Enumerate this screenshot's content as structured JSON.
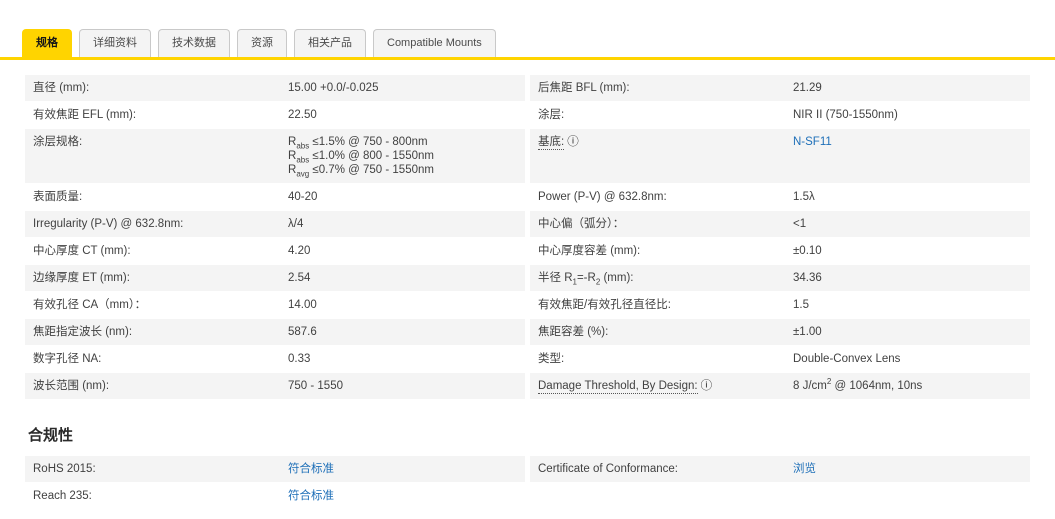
{
  "tabs": [
    {
      "label": "规格",
      "active": true
    },
    {
      "label": "详细资料",
      "active": false
    },
    {
      "label": "技术数据",
      "active": false
    },
    {
      "label": "资源",
      "active": false
    },
    {
      "label": "相关产品",
      "active": false
    },
    {
      "label": "Compatible Mounts",
      "active": false
    }
  ],
  "icons": {
    "info": "ⓘ"
  },
  "colors": {
    "accent_yellow": "#ffd400",
    "link_blue": "#1e6fb8",
    "row_stripe": "#f4f4f4"
  },
  "spec_rows": [
    {
      "left": {
        "label": "直径 (mm):",
        "value": "15.00 +0.0/-0.025"
      },
      "right": {
        "label": "后焦距 BFL (mm):",
        "value": "21.29"
      }
    },
    {
      "left": {
        "label": "有效焦距 EFL (mm):",
        "value": "22.50"
      },
      "right": {
        "label": "涂层:",
        "value": "NIR II (750-1550nm)"
      }
    },
    {
      "left": {
        "label": "涂层规格:",
        "value_lines": [
          [
            {
              "t": "R"
            },
            {
              "sub": "abs"
            },
            {
              "t": " ≤1.5% @ 750 - 800nm"
            }
          ],
          [
            {
              "t": "R"
            },
            {
              "sub": "abs"
            },
            {
              "t": " ≤1.0% @ 800 - 1550nm"
            }
          ],
          [
            {
              "t": "R"
            },
            {
              "sub": "avg"
            },
            {
              "t": " ≤0.7% @ 750 - 1550nm"
            }
          ]
        ]
      },
      "right": {
        "label": "基底:",
        "info": true,
        "value": "N-SF11",
        "link": true
      }
    },
    {
      "left": {
        "label": "表面质量:",
        "value": "40-20"
      },
      "right": {
        "label": "Power (P-V) @ 632.8nm:",
        "value": "1.5λ"
      }
    },
    {
      "left": {
        "label": "Irregularity (P-V) @ 632.8nm:",
        "value": "λ/4"
      },
      "right": {
        "label": "中心偏（弧分）：",
        "value": "<1"
      }
    },
    {
      "left": {
        "label": "中心厚度 CT (mm):",
        "value": "4.20"
      },
      "right": {
        "label": "中心厚度容差 (mm):",
        "value": "±0.10"
      }
    },
    {
      "left": {
        "label": "边缘厚度 ET (mm):",
        "value": "2.54"
      },
      "right": {
        "label": [
          {
            "t": "半径 R"
          },
          {
            "sub": "1"
          },
          {
            "t": "=-R"
          },
          {
            "sub": "2"
          },
          {
            "t": " (mm):"
          }
        ],
        "value": "34.36"
      }
    },
    {
      "left": {
        "label": "有效孔径 CA（mm）：",
        "value": "14.00"
      },
      "right": {
        "label": "有效焦距/有效孔径直径比:",
        "value": "1.5"
      }
    },
    {
      "left": {
        "label": "焦距指定波长 (nm):",
        "value": "587.6"
      },
      "right": {
        "label": "焦距容差 (%):",
        "value": "±1.00"
      }
    },
    {
      "left": {
        "label": "数字孔径 NA:",
        "value": "0.33"
      },
      "right": {
        "label": "类型:",
        "value": "Double-Convex Lens"
      }
    },
    {
      "left": {
        "label": "波长范围 (nm):",
        "value": "750 - 1550"
      },
      "right": {
        "label": "Damage Threshold, By Design:",
        "info": true,
        "value": [
          {
            "t": "8 J/cm"
          },
          {
            "sup": "2"
          },
          {
            "t": " @ 1064nm, 10ns"
          }
        ]
      }
    }
  ],
  "compliance": {
    "title": "合规性",
    "rows": [
      {
        "left": {
          "label": "RoHS 2015:",
          "value": "符合标准",
          "link": true
        },
        "right": {
          "label": "Certificate of Conformance:",
          "value": "浏览",
          "link": true
        }
      },
      {
        "left": {
          "label": "Reach 235:",
          "value": "符合标准",
          "link": true
        },
        "right": null
      }
    ]
  }
}
